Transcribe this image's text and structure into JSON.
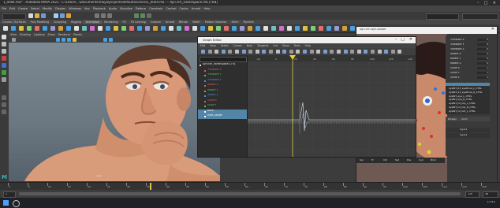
{
  "window": {
    "title": "1_0004.ma* - Autodesk MAYA 2022 : C:\\Users\\...\\Documents\\maya\\projects\\default\\scenes\\1_0004.ma --- Ayn.ctrl_nameSpace.mb [TKB]",
    "controls": [
      "–",
      "□",
      "✕"
    ]
  },
  "menubar": [
    "File",
    "Edit",
    "Create",
    "Select",
    "Modify",
    "Display",
    "Windows",
    "Key",
    "Playback",
    "Audio",
    "Visualize",
    "Deform",
    "Constrain",
    "Control",
    "Cache",
    "Arnold",
    "Help"
  ],
  "shelf_tabs": [
    "Curves / Surfaces",
    "Poly Modeling",
    "Sculpting",
    "Rigging",
    "Animation",
    "Rendering",
    "FX",
    "FX Caching",
    "Custom",
    "Arnold",
    "Bifrost",
    "MASH",
    "Motion Graphics",
    "XGen",
    "Pipeline"
  ],
  "viewport": {
    "menu": [
      "View",
      "Shading",
      "Lighting",
      "Show",
      "Renderer",
      "Panels"
    ],
    "camera_label": "persp"
  },
  "graph_editor": {
    "title": "Graph Editor",
    "menu": [
      "Edit",
      "View",
      "Select",
      "Curves",
      "Keys",
      "Tangents",
      "List",
      "Show",
      "Tools",
      "Help"
    ],
    "search_placeholder": "",
    "outliner_rows": [
      {
        "label": "Ayn:ctrl_nameSpace:CTRL",
        "color": "#e6e6e6"
      },
      {
        "label": "Translate X",
        "color": "#e05a5a"
      },
      {
        "label": "Translate Y",
        "color": "#5ac05a"
      },
      {
        "label": "Translate Z",
        "color": "#5a8ae0"
      },
      {
        "label": "Rotate X",
        "color": "#e05a5a"
      },
      {
        "label": "Rotate Y",
        "color": "#5ac05a"
      },
      {
        "label": "Rotate Z",
        "color": "#5a8ae0"
      },
      {
        "label": "Scale X",
        "color": "#e05a5a"
      },
      {
        "label": "Scale Y",
        "color": "#5ac05a"
      },
      {
        "label": "blink",
        "color": "#ffffff",
        "selected": true
      },
      {
        "label": "eyes_target",
        "color": "#ffffff",
        "selected": true
      }
    ],
    "ruler": [
      "-20",
      "0",
      "20",
      "40",
      "60",
      "80",
      "100",
      "120",
      "140"
    ]
  },
  "second_window": {
    "title": "Ayn.ctrl.Ayn.phase",
    "attributes": [
      {
        "label": "Translate X",
        "value": "0"
      },
      {
        "label": "Translate Y",
        "value": "0"
      },
      {
        "label": "Translate Z",
        "value": "0"
      },
      {
        "label": "Rotate X",
        "value": "0"
      },
      {
        "label": "Rotate Y",
        "value": "0"
      },
      {
        "label": "Rotate Z",
        "value": "0"
      },
      {
        "label": "Scale X",
        "value": "1"
      },
      {
        "label": "Scale Y",
        "value": "1"
      },
      {
        "label": "Scale Z",
        "value": "1"
      }
    ],
    "list_items": [
      "AyaBrt_03_eyeBrow_L_CTRL",
      "AyaBrt_03_eyeBrow_R_CTRL",
      "AyaBrt_eye_L_CTRL",
      "AyaBrt_eye_R_CTRL",
      "AyaBrt_lid_top_L_CTRL",
      "AyaBrt_lid_top_R_CTRL",
      "AyaBrt_lid_bot_L_CTRL"
    ],
    "layer_tabs": [
      "Display",
      "Anim"
    ],
    "layers": [
      "layer1",
      "layer2"
    ],
    "bottom_tabs": [
      "Sel",
      "Trl",
      "Ctrl",
      "Set",
      "Pos",
      "Cycl",
      "Blnd"
    ]
  },
  "timeline": {
    "ticks": [
      "1",
      "5",
      "10",
      "15",
      "20",
      "25",
      "30",
      "35",
      "40",
      "45",
      "50",
      "55",
      "60",
      "65",
      "70",
      "75",
      "80",
      "85",
      "90",
      "95",
      "100",
      "105",
      "110",
      "115",
      "120"
    ],
    "current_frame": "38",
    "range_start": "1",
    "range_end": "120"
  },
  "taskbar_time": "11:42"
}
